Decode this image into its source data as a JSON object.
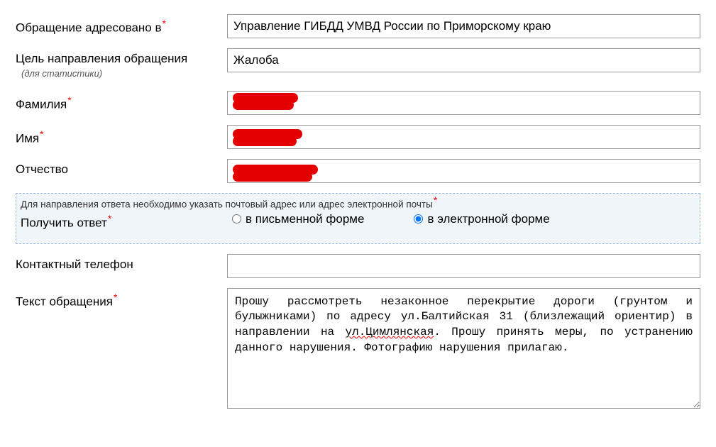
{
  "fields": {
    "recipient": {
      "label": "Обращение адресовано в",
      "required": true,
      "value": "Управление ГИБДД УМВД России по Приморскому краю"
    },
    "purpose": {
      "label": "Цель направления обращения",
      "sublabel": "(для статистики)",
      "required": false,
      "value": "Жалоба"
    },
    "lastname": {
      "label": "Фамилия",
      "required": true,
      "value": ""
    },
    "firstname": {
      "label": "Имя",
      "required": true,
      "value": ""
    },
    "middlename": {
      "label": "Отчество",
      "required": false,
      "value": ""
    },
    "response": {
      "legend": "Для направления ответа необходимо указать почтовый адрес или адрес электронной почты",
      "label": "Получить ответ",
      "required": true,
      "options": {
        "written": "в письменной форме",
        "electronic": "в электронной форме"
      },
      "selected": "electronic"
    },
    "phone": {
      "label": "Контактный телефон",
      "required": false,
      "value": ""
    },
    "message": {
      "label": "Текст обращения",
      "required": true,
      "value_pre": "Прошу рассмотреть незаконное перекрытие дороги (грунтом и булыжниками) по адресу ул.Балтийская 31 (близлежащий ориентир) в направлении на ",
      "value_spell": "ул.Цимлянская",
      "value_post": ". Прошу принять меры, по устранению данного нарушения. Фотографию нарушения прилагаю."
    }
  }
}
